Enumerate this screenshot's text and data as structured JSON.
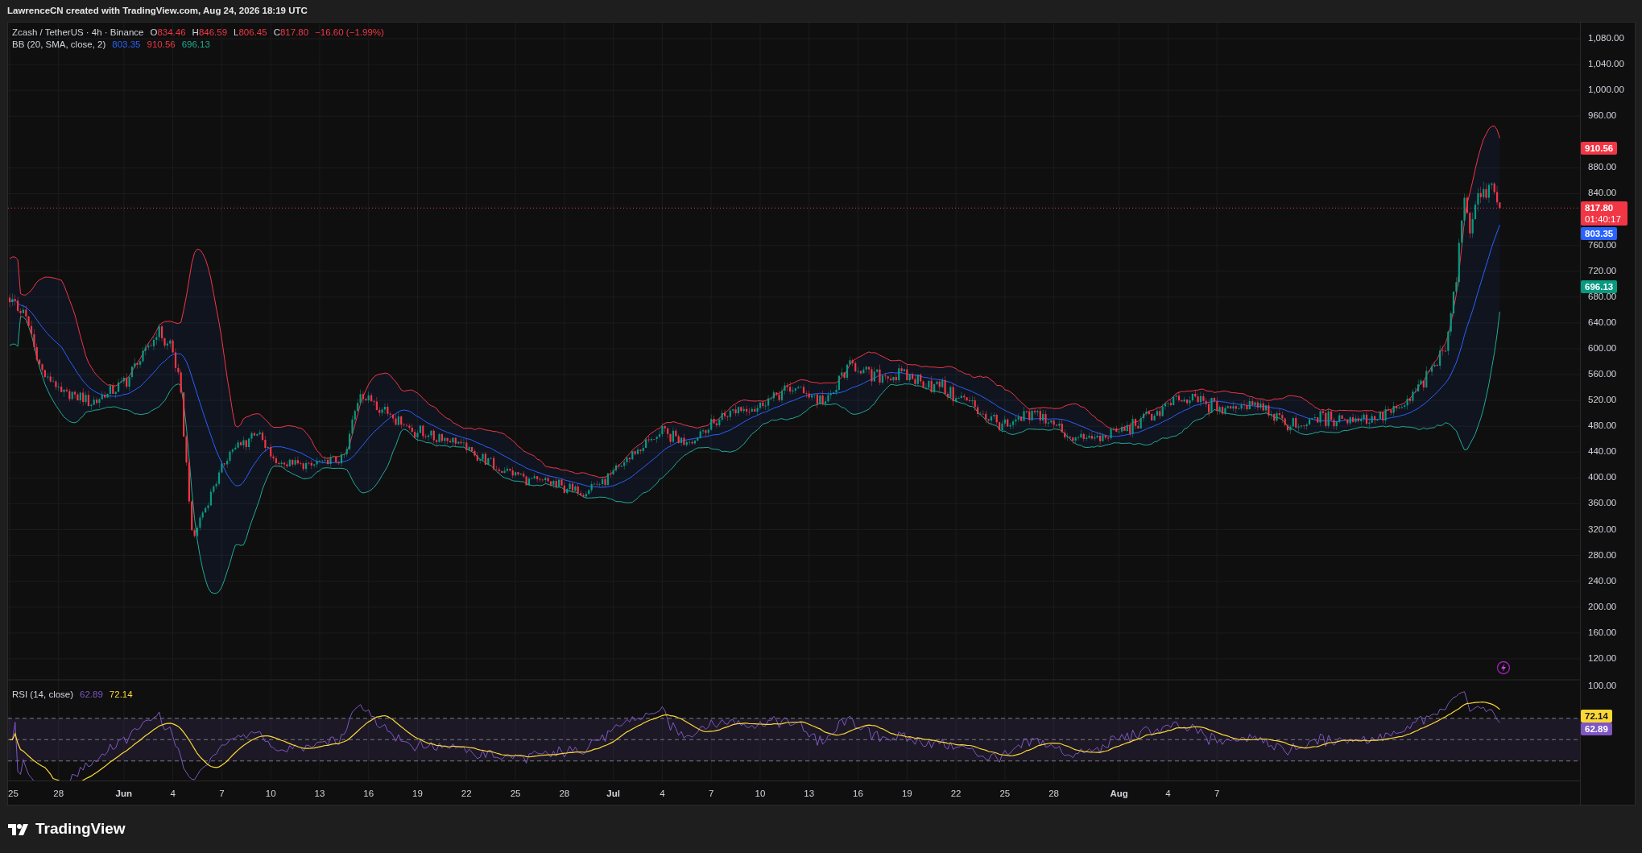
{
  "header": {
    "credit": "LawrenceCN created with TradingView.com, Aug 24, 2026 18:19 UTC"
  },
  "legend": {
    "symbol": "Zcash / TetherUS · 4h · Binance",
    "ohlc": [
      {
        "label": "O",
        "value": "834.46",
        "color": "#f23645"
      },
      {
        "label": "H",
        "value": "846.59",
        "color": "#f23645"
      },
      {
        "label": "L",
        "value": "806.45",
        "color": "#f23645"
      },
      {
        "label": "C",
        "value": "817.80",
        "color": "#f23645"
      },
      {
        "value": "−16.60 (−1.99%)",
        "color": "#f23645"
      }
    ]
  },
  "bb_legend": {
    "label": "BB (20, SMA, close, 2)",
    "values": [
      {
        "text": "803.35",
        "color": "#2962ff"
      },
      {
        "text": "910.56",
        "color": "#f23645"
      },
      {
        "text": "696.13",
        "color": "#22ab94"
      }
    ]
  },
  "price_axis": {
    "ticks": [
      "1,080.00",
      "1,040.00",
      "1,000.00",
      "960.00",
      "880.00",
      "840.00",
      "760.00",
      "720.00",
      "680.00",
      "640.00",
      "600.00",
      "560.00",
      "520.00",
      "480.00",
      "440.00",
      "400.00",
      "360.00",
      "320.00",
      "280.00",
      "240.00",
      "200.00",
      "160.00",
      "120.00"
    ],
    "badges": [
      {
        "text": "910.56",
        "color": "#f23645"
      },
      {
        "text": "817.80",
        "countdown": "01:40:17",
        "color": "#f23645"
      },
      {
        "text": "803.35",
        "color": "#2962ff"
      },
      {
        "text": "696.13",
        "color": "#089981"
      }
    ]
  },
  "rsi_legend": {
    "label": "RSI (14, close)",
    "values": [
      {
        "text": "62.89",
        "color": "#7e57c2"
      },
      {
        "text": "72.14",
        "color": "#fdd835"
      }
    ]
  },
  "rsi_axis": {
    "ticks": [
      "100.00"
    ],
    "badges": [
      {
        "text": "72.14",
        "color": "#fdd835"
      },
      {
        "text": "62.89",
        "color": "#7e57c2"
      }
    ]
  },
  "x_axis": [
    {
      "label": "25",
      "kind": "day"
    },
    {
      "label": "28",
      "kind": "day"
    },
    {
      "label": "Jun",
      "kind": "month"
    },
    {
      "label": "4",
      "kind": "day"
    },
    {
      "label": "7",
      "kind": "day"
    },
    {
      "label": "10",
      "kind": "day"
    },
    {
      "label": "13",
      "kind": "day"
    },
    {
      "label": "16",
      "kind": "day"
    },
    {
      "label": "19",
      "kind": "day"
    },
    {
      "label": "22",
      "kind": "day"
    },
    {
      "label": "25",
      "kind": "day"
    },
    {
      "label": "28",
      "kind": "day"
    },
    {
      "label": "Jul",
      "kind": "month"
    },
    {
      "label": "4",
      "kind": "day"
    },
    {
      "label": "7",
      "kind": "day"
    },
    {
      "label": "10",
      "kind": "day"
    },
    {
      "label": "13",
      "kind": "day"
    },
    {
      "label": "16",
      "kind": "day"
    },
    {
      "label": "19",
      "kind": "day"
    },
    {
      "label": "22",
      "kind": "day"
    },
    {
      "label": "25",
      "kind": "day"
    },
    {
      "label": "28",
      "kind": "day"
    },
    {
      "label": "Aug",
      "kind": "month"
    },
    {
      "label": "4",
      "kind": "day"
    },
    {
      "label": "7",
      "kind": "day"
    }
  ],
  "footer": {
    "logo": "TradingView"
  }
}
